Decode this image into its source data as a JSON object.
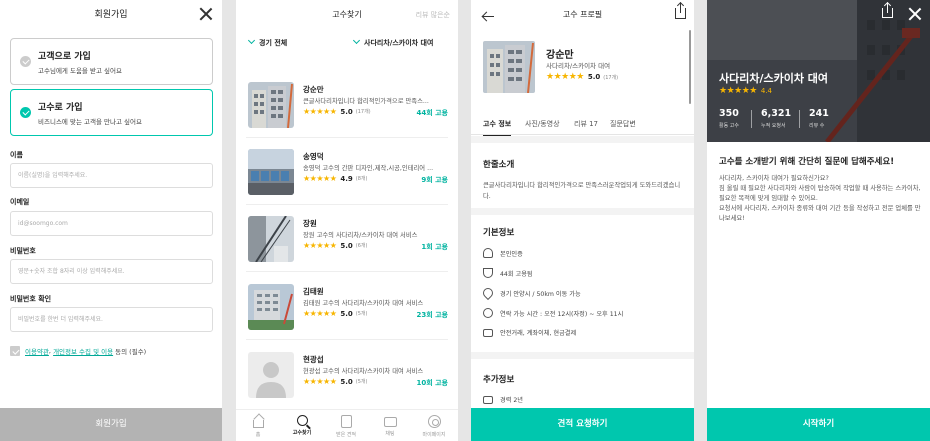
{
  "colors": {
    "accent": "#00c7ae",
    "accent_text": "#00b3a0",
    "star": "#f7b500",
    "disabled_button": "#b3b3b3",
    "bottom_button": "#00c7ae"
  },
  "signup": {
    "title": "회원가입",
    "options": [
      {
        "title": "고객으로 가입",
        "desc": "고수님에게 도움을 받고 싶어요",
        "selected": false
      },
      {
        "title": "고수로 가입",
        "desc": "비즈니스에 맞는 고객을 만나고 싶어요",
        "selected": true
      }
    ],
    "fields": [
      {
        "label": "이름",
        "placeholder": "이름(실명)을 입력해주세요."
      },
      {
        "label": "이메일",
        "placeholder": "id@soomgo.com"
      },
      {
        "label": "비밀번호",
        "placeholder": "영문+숫자 조합 8자리 이상 입력해주세요."
      },
      {
        "label": "비밀번호 확인",
        "placeholder": "비밀번호를 한번 더 입력해주세요."
      }
    ],
    "agree_terms": "이용약관",
    "agree_sep": ", ",
    "agree_privacy": "개인정보 수집 및 이용",
    "agree_suffix": " 동의 (필수)",
    "submit": "회원가입"
  },
  "search": {
    "title": "고수찾기",
    "right": "리뷰 많은순",
    "filter_region": "경기 전체",
    "filter_category": "사다리차/스카이차 대여",
    "pros": [
      {
        "name": "강순만",
        "desc": "큰글사다리차입니다 합리적인가격으로 만족스...",
        "score": "5.0",
        "count": "(17개)",
        "rating": 5,
        "hires": "44회 고용"
      },
      {
        "name": "송영덕",
        "desc": "송영덕 고수의 간판 디자인,제작,시공,인테리어 ...",
        "score": "4.9",
        "count": "(8개)",
        "rating": 5,
        "hires": "9회 고용"
      },
      {
        "name": "장원",
        "desc": "장원 고수의 사다리차/스카이차 대여 서비스",
        "score": "5.0",
        "count": "(6개)",
        "rating": 5,
        "hires": "1회 고용"
      },
      {
        "name": "김태원",
        "desc": "김태원 고수의 사다리차/스카이차 대여 서비스",
        "score": "5.0",
        "count": "(5개)",
        "rating": 5,
        "hires": "23회 고용"
      },
      {
        "name": "현광섭",
        "desc": "현광섭 고수의 사다리차/스카이차 대여 서비스",
        "score": "5.0",
        "count": "(5개)",
        "rating": 5,
        "hires": "10회 고용"
      }
    ],
    "tabs": [
      {
        "label": "홈",
        "icon": "home-icon",
        "active": false
      },
      {
        "label": "고수찾기",
        "icon": "search-icon",
        "active": true
      },
      {
        "label": "받은 견적",
        "icon": "document-icon",
        "active": false
      },
      {
        "label": "채팅",
        "icon": "chat-icon",
        "active": false
      },
      {
        "label": "마이페이지",
        "icon": "profile-icon",
        "active": false
      }
    ]
  },
  "profile": {
    "title": "고수 프로필",
    "name": "강순만",
    "category": "사다리차/스카이차 대여",
    "score": "5.0",
    "count": "(17개)",
    "tabs": [
      "고수 정보",
      "사진/동영상",
      "리뷰 17",
      "질문답변"
    ],
    "intro_title": "한줄소개",
    "intro": "큰글사다리차입니다 합리적인가격으로 만족스러운작업되게 도와드리겠습니다.",
    "basic_title": "기본정보",
    "basic": [
      {
        "icon": "person-icon",
        "text": "본인인증"
      },
      {
        "icon": "trophy-icon",
        "text": "44회 고용됨"
      },
      {
        "icon": "location-icon",
        "text": "경기 안양시 / 50km 이동 가능"
      },
      {
        "icon": "clock-icon",
        "text": "연락 가능 시간 : 오전 12시(자정) ~ 오후 11시"
      },
      {
        "icon": "card-icon",
        "text": "안전거래, 계좌이체, 현금결제"
      }
    ],
    "extra_title": "추가정보",
    "extra": [
      {
        "icon": "briefcase-icon",
        "text": "경력 2년"
      }
    ],
    "cta": "견적 요청하기"
  },
  "request": {
    "title": "사다리차/스카이차 대여",
    "rating": "4.4",
    "stats": [
      {
        "value": "350",
        "label": "활동 고수"
      },
      {
        "value": "6,321",
        "label": "누적 요청서"
      },
      {
        "value": "241",
        "label": "리뷰 수"
      }
    ],
    "question": "고수를 소개받기 위해 간단히 질문에 답해주세요!",
    "description": [
      "사다리차, 스카이차 대여가 필요하신가요?",
      "짐 올릴 때 필요한 사다리차와 사람이 탑승하여 작업할 때 사용하는 스카이차, 필요한 목적에 맞게 임대할 수 있어요.",
      "요청서에 사다리차, 스카이차 종류와 대여 기간 등을 작성하고 전문 업체를 만나보세요!"
    ],
    "cta": "시작하기"
  }
}
